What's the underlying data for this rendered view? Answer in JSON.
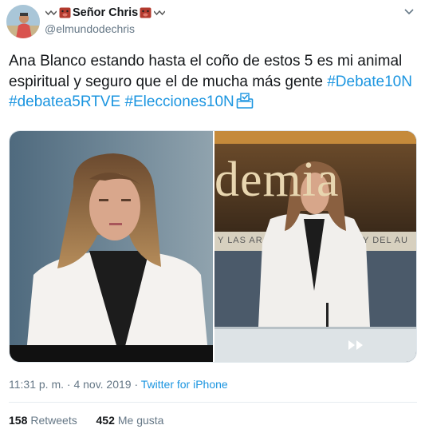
{
  "tweet": {
    "display_name": "Señor Chris",
    "handle": "@elmundodechris",
    "text_plain": "Ana Blanco estando hasta el coño de estos 5 es mi animal espiritual y seguro que el de mucha más gente",
    "hashtags": [
      "#Debate10N",
      "#debatea5RTVE",
      "#Elecciones10N"
    ],
    "time": "11:31 p. m. · 4 nov. 2019 · ",
    "source": "Twitter for iPhone",
    "retweets_count": "158",
    "retweets_label": "Retweets",
    "likes_count": "452",
    "likes_label": "Me gusta",
    "right_photo_backdrop_text": "demia",
    "right_photo_banner_left": "Y LAS AR",
    "right_photo_banner_right": "Y DEL AU"
  },
  "icons": [
    "avatar",
    "pig-emoji-icon",
    "wave-icon",
    "chevron-down-icon",
    "ballot-box-icon"
  ],
  "colors": {
    "link": "#1b95e0",
    "muted": "#657786",
    "text": "#14171a"
  }
}
